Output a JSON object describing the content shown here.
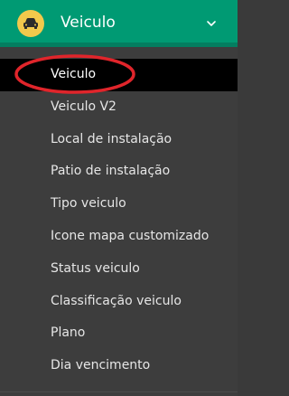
{
  "header": {
    "title": "Veiculo",
    "icon": "car-icon",
    "chevron": "chevron-down-icon",
    "bg_color": "#009a73",
    "icon_bg_color": "#f2c94c"
  },
  "menu": {
    "items": [
      {
        "label": "Veiculo",
        "active": true
      },
      {
        "label": "Veiculo V2",
        "active": false
      },
      {
        "label": "Local de instalação",
        "active": false
      },
      {
        "label": "Patio de instalação",
        "active": false
      },
      {
        "label": "Tipo veiculo",
        "active": false
      },
      {
        "label": "Icone mapa customizado",
        "active": false
      },
      {
        "label": "Status veiculo",
        "active": false
      },
      {
        "label": "Classificação veiculo",
        "active": false
      },
      {
        "label": "Plano",
        "active": false
      },
      {
        "label": "Dia vencimento",
        "active": false
      }
    ]
  },
  "annotation": {
    "type": "red-ellipse",
    "color": "#e0252b"
  }
}
